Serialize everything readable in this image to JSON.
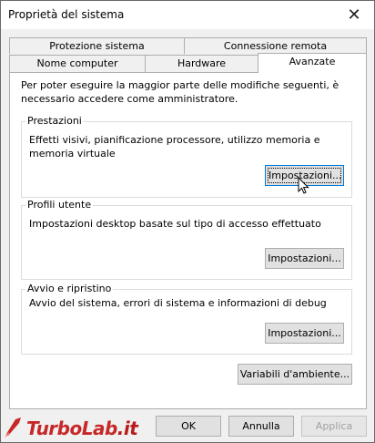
{
  "window": {
    "title": "Proprietà del sistema"
  },
  "tabs": {
    "back_row": [
      "Protezione sistema",
      "Connessione remota"
    ],
    "front_row": [
      "Nome computer",
      "Hardware",
      "Avanzate"
    ]
  },
  "intro_text": "Per poter eseguire la maggior parte delle modifiche seguenti, è necessario accedere come amministratore.",
  "groups": [
    {
      "title": "Prestazioni",
      "description": "Effetti visivi, pianificazione processore, utilizzo memoria e memoria virtuale",
      "button": "Impostazioni..."
    },
    {
      "title": "Profili utente",
      "description": "Impostazioni desktop basate sul tipo di accesso effettuato",
      "button": "Impostazioni..."
    },
    {
      "title": "Avvio e ripristino",
      "description": "Avvio del sistema, errori di sistema e informazioni di debug",
      "button": "Impostazioni..."
    }
  ],
  "env_button": "Variabili d'ambiente...",
  "footer": {
    "ok": "OK",
    "cancel": "Annulla",
    "apply": "Applica"
  },
  "watermark": {
    "text_main": "TurboLab",
    "text_suffix": ".it"
  },
  "icons": {
    "close": "close-icon",
    "cursor": "mouse-pointer-icon"
  }
}
